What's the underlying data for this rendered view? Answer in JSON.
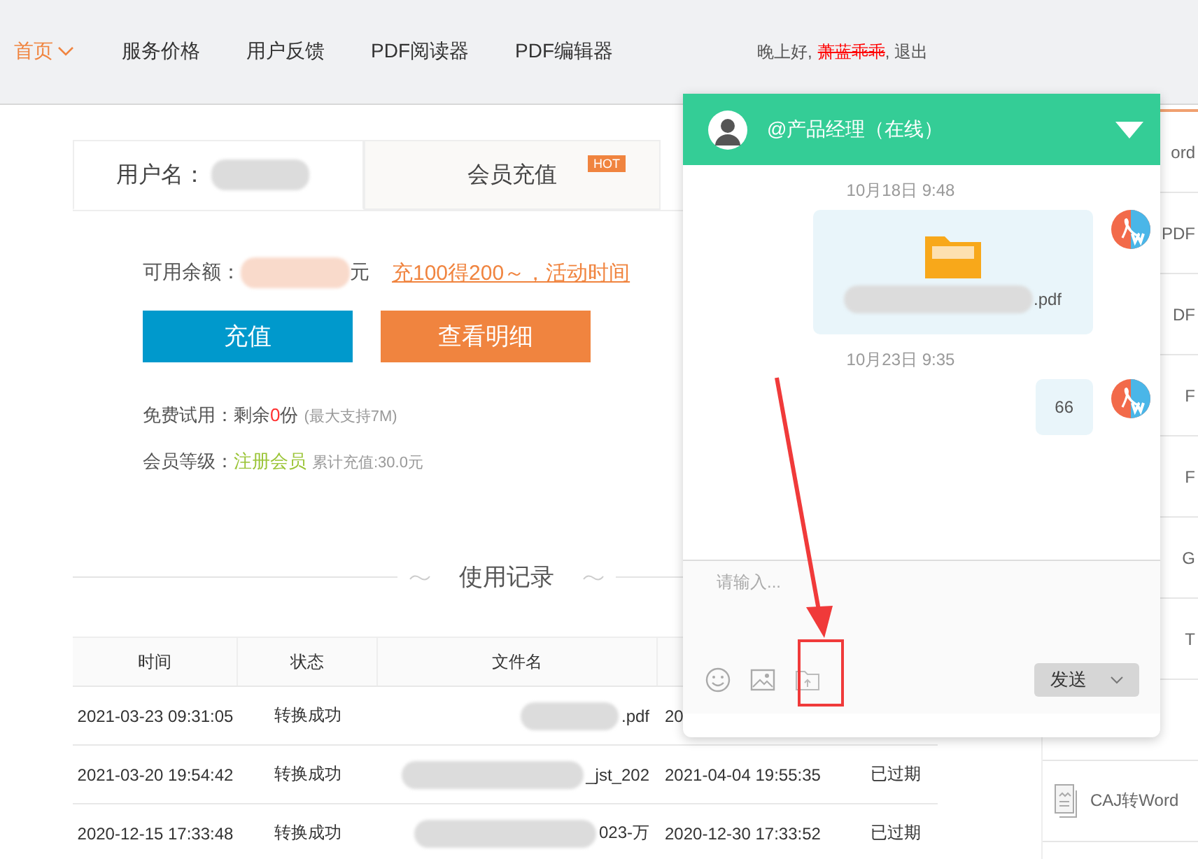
{
  "nav": {
    "items": [
      {
        "label": "首页",
        "selected": true
      },
      {
        "label": "服务价格",
        "selected": false
      },
      {
        "label": "用户反馈",
        "selected": false
      },
      {
        "label": "PDF阅读器",
        "selected": false
      },
      {
        "label": "PDF编辑器",
        "selected": false
      }
    ],
    "greeting": "晚上好,",
    "username": "萧蓝乖乖",
    "logout": ", 退出"
  },
  "account": {
    "tabs": [
      {
        "label": "用户名：",
        "selected": true
      },
      {
        "label": "会员充值",
        "badge": "HOT",
        "selected": false
      }
    ],
    "balance_label": "可用余额：",
    "balance_unit": "元",
    "promo_link": "充100得200～，活动时间",
    "buttons": [
      {
        "label": "充值",
        "kind": "primary"
      },
      {
        "label": "查看明细",
        "kind": "secondary"
      }
    ],
    "trial_label": "免费试用：",
    "trial_prefix": "剩余",
    "trial_count": "0",
    "trial_suffix": "份",
    "trial_note": "(最大支持7M)",
    "level_label": "会员等级：",
    "level": "注册会员",
    "total": "累计充值:30.0元"
  },
  "history": {
    "title": "使用记录",
    "columns": [
      "时间",
      "状态",
      "文件名"
    ],
    "rows": [
      {
        "time": "2021-03-23 09:31:05",
        "status": "转换成功",
        "file": ".pdf",
        "column_4": "20"
      },
      {
        "time": "2021-03-20 19:54:42",
        "status": "转换成功",
        "file": "_jst_202",
        "column_4": "2021-04-04 19:55:35",
        "column_5": "已过期"
      },
      {
        "time": "2020-12-15 17:33:48",
        "status": "转换成功",
        "file": "023-万",
        "column_4": "2020-12-30 17:33:52",
        "column_5": "已过期"
      }
    ]
  },
  "sidebar": {
    "items": [
      {
        "label": "ord",
        "kind": "text"
      },
      {
        "label": "PDF",
        "kind": "text"
      },
      {
        "label": "DF",
        "kind": "text"
      },
      {
        "label": "F",
        "kind": "text"
      },
      {
        "label": "F",
        "kind": "text"
      },
      {
        "label": "G",
        "kind": "text"
      },
      {
        "label": "T",
        "kind": "text"
      },
      {
        "kind": "blank"
      },
      {
        "label": "CAJ转Word",
        "kind": "caj"
      }
    ]
  },
  "chat": {
    "title": "@产品经理（在线）",
    "messages": [
      {
        "kind": "time",
        "text": "10月18日 9:48"
      },
      {
        "kind": "file",
        "text": ".pdf"
      },
      {
        "kind": "time",
        "text": "10月23日 9:35"
      },
      {
        "kind": "text",
        "text": "66"
      }
    ],
    "placeholder": "请输入...",
    "send": "发送"
  }
}
